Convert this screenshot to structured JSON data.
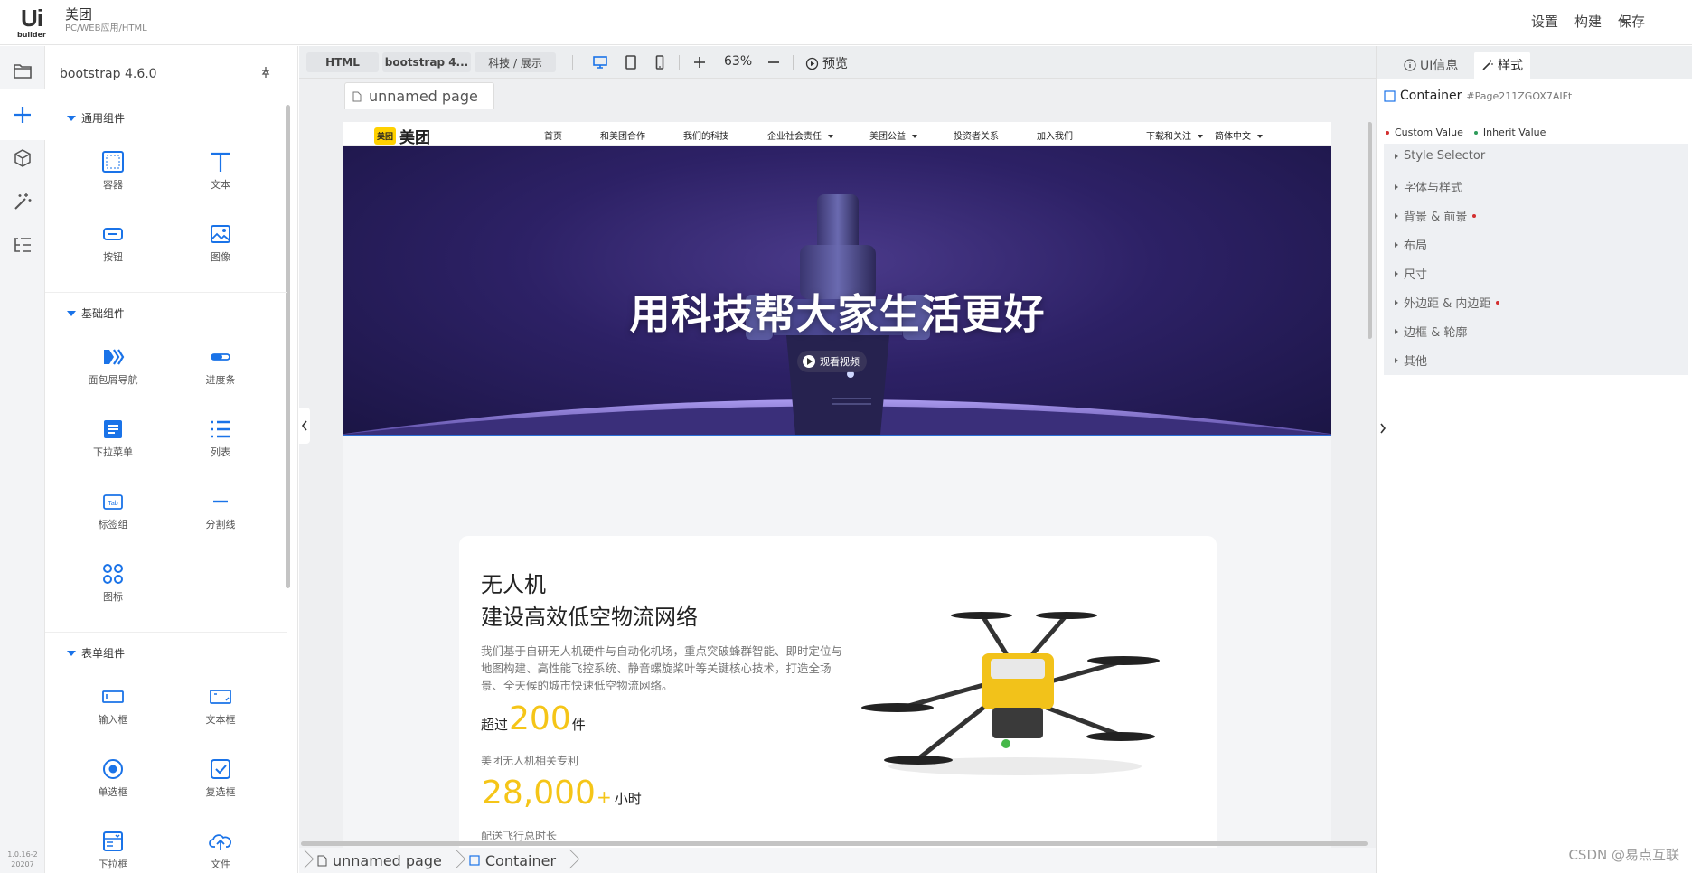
{
  "app": {
    "logo_text": "Ui",
    "logo_sub": "builder",
    "project_name": "美团",
    "project_type": "PC/WEB应用/HTML",
    "actions": [
      "设置",
      "构建",
      "保存"
    ],
    "version": "1.0.16-220207"
  },
  "rail": {
    "icons": [
      "folder-icon",
      "plus-icon",
      "cube-icon",
      "magic-wand-icon",
      "tree-list-icon"
    ]
  },
  "panel": {
    "framework": "bootstrap 4.6.0",
    "sections": [
      {
        "title": "通用组件",
        "items": [
          {
            "label": "容器",
            "icon": "container-icon"
          },
          {
            "label": "文本",
            "icon": "text-icon"
          },
          {
            "label": "按钮",
            "icon": "button-icon"
          },
          {
            "label": "图像",
            "icon": "image-icon"
          }
        ]
      },
      {
        "title": "基础组件",
        "items": [
          {
            "label": "面包屑导航",
            "icon": "breadcrumb-icon"
          },
          {
            "label": "进度条",
            "icon": "progress-icon"
          },
          {
            "label": "下拉菜单",
            "icon": "dropdown-icon"
          },
          {
            "label": "列表",
            "icon": "list-icon"
          },
          {
            "label": "标签组",
            "icon": "tab-icon"
          },
          {
            "label": "分割线",
            "icon": "divider-icon"
          },
          {
            "label": "图标",
            "icon": "command-icon"
          }
        ]
      },
      {
        "title": "表单组件",
        "items": [
          {
            "label": "输入框",
            "icon": "input-icon"
          },
          {
            "label": "文本框",
            "icon": "textarea-icon"
          },
          {
            "label": "单选框",
            "icon": "radio-icon"
          },
          {
            "label": "复选框",
            "icon": "checkbox-icon"
          },
          {
            "label": "下拉框",
            "icon": "select-icon"
          },
          {
            "label": "文件",
            "icon": "upload-icon"
          }
        ]
      }
    ]
  },
  "toolbar": {
    "tabs": [
      "HTML",
      "bootstrap 4...",
      "科技 / 展示"
    ],
    "zoom": "63%",
    "preview": "预览"
  },
  "canvas": {
    "page_tab": "unnamed page",
    "site": {
      "logo_badge": "美团",
      "logo_word": "美团",
      "nav": [
        "首页",
        "和美团合作",
        "我们的科技",
        "企业社会责任",
        "美团公益",
        "投资者关系",
        "加入我们",
        "下载和关注",
        "简体中文"
      ],
      "hero_title": "用科技帮大家生活更好",
      "video_label": "观看视频",
      "card": {
        "title1": "无人机",
        "title2": "建设高效低空物流网络",
        "desc": "我们基于自研无人机硬件与自动化机场，重点突破蜂群智能、即时定位与地图构建、高性能飞控系统、静音螺旋桨叶等关键核心技术，打造全场景、全天候的城市快速低空物流网络。",
        "stat1_prefix": "超过",
        "stat1_value": "200",
        "stat1_suffix": "件",
        "stat1_label": "美团无人机相关专利",
        "stat2_value": "28,000",
        "stat2_plus": "+",
        "stat2_suffix": "小时",
        "stat2_label": "配送飞行总时长"
      }
    },
    "breadcrumb": [
      "unnamed page",
      "Container"
    ]
  },
  "inspector": {
    "tabs": [
      "UI信息",
      "样式"
    ],
    "target_name": "Container",
    "target_id": "#Page211ZGOX7AIFt",
    "legend": [
      {
        "label": "Custom Value",
        "color": "#d32f2f"
      },
      {
        "label": "Inherit Value",
        "color": "#2e9b5a"
      }
    ],
    "groups": [
      "Style Selector",
      "字体与样式",
      "背景 & 前景",
      "布局",
      "尺寸",
      "外边距 & 内边距",
      "边框 & 轮廓",
      "其他"
    ],
    "marked_groups": [
      2,
      5
    ]
  },
  "watermark": "CSDN @易点互联"
}
